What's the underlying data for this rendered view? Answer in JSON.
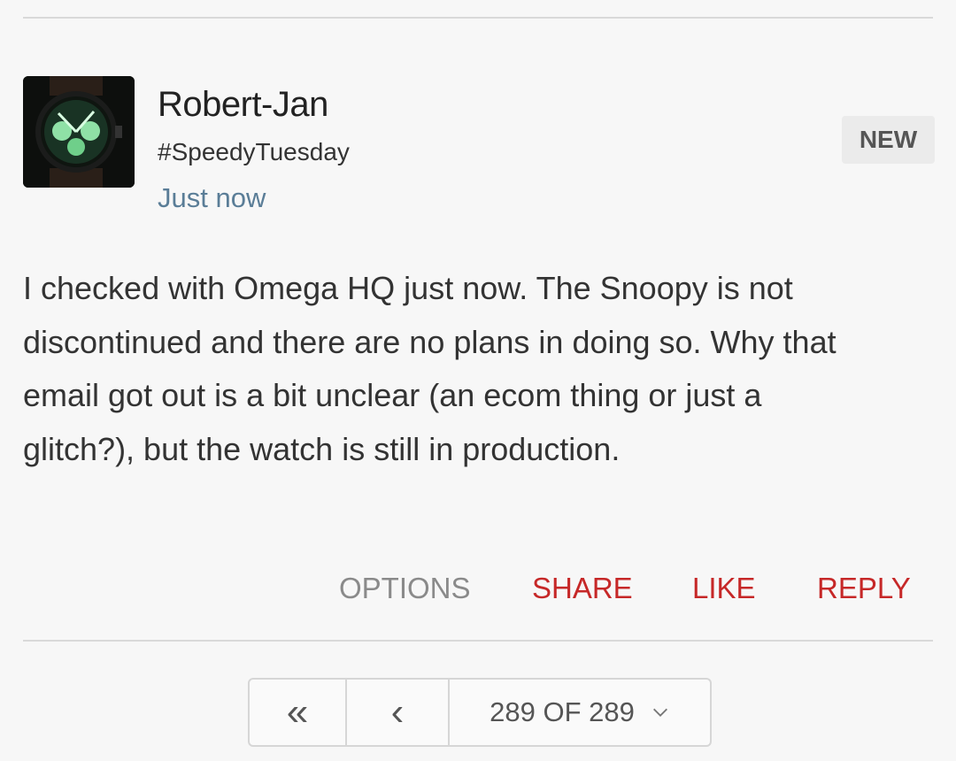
{
  "post": {
    "author": "Robert-Jan",
    "tagline": "#SpeedyTuesday",
    "time": "Just now",
    "badge": "NEW",
    "body": "I checked with Omega HQ just now. The Snoopy is not discontinued and there are no plans in doing so. Why that email got out is a bit unclear (an ecom thing or just a glitch?), but the watch is still in production."
  },
  "actions": {
    "options": "OPTIONS",
    "share": "SHARE",
    "like": "LIKE",
    "reply": "REPLY"
  },
  "pagination": {
    "first_icon": "«",
    "prev_icon": "‹",
    "page_label": "289 OF 289"
  },
  "colors": {
    "accent": "#c62828",
    "link": "#5a7d97",
    "muted": "#8a8a8a"
  },
  "icons": {
    "avatar": "watch-avatar-icon",
    "first": "double-chevron-left-icon",
    "prev": "chevron-left-icon",
    "dropdown": "chevron-down-icon"
  }
}
